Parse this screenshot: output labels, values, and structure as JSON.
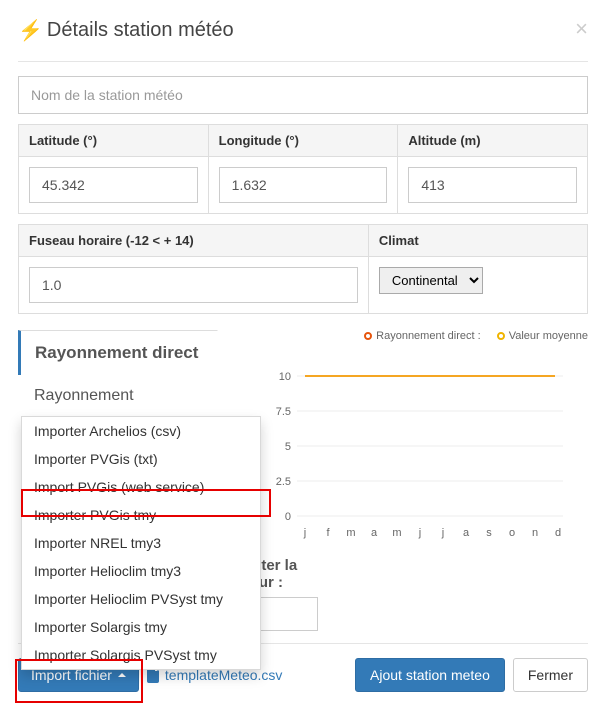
{
  "modal": {
    "title": "Détails station météo",
    "close_label": "×"
  },
  "station_name": {
    "placeholder": "Nom de la station météo",
    "value": ""
  },
  "fields": {
    "latitude": {
      "label": "Latitude (°)",
      "value": "45.342"
    },
    "longitude": {
      "label": "Longitude (°)",
      "value": "1.632"
    },
    "altitude": {
      "label": "Altitude (m)",
      "value": "413"
    },
    "timezone": {
      "label": "Fuseau horaire (-12 < + 14)",
      "value": "1.0"
    },
    "climate": {
      "label": "Climat",
      "value": "Continental"
    }
  },
  "tabs": {
    "active": "Rayonnement direct",
    "next": "Rayonnement"
  },
  "dropdown": {
    "items": [
      "Importer Archelios (csv)",
      "Importer PVGis (txt)",
      "Import PVGis (web service)",
      "Importer PVGis tmy",
      "Importer NREL tmy3",
      "Importer Helioclim tmy3",
      "Importer Helioclim PVSyst tmy",
      "Importer Solargis tmy",
      "Importer Solargis PVSyst tmy"
    ]
  },
  "legend": {
    "series1": "Rayonnement direct :",
    "series2": "Valeur moyenne"
  },
  "chart_data": {
    "type": "line",
    "categories": [
      "j",
      "f",
      "m",
      "a",
      "m",
      "j",
      "j",
      "a",
      "s",
      "o",
      "n",
      "d"
    ],
    "series": [
      {
        "name": "Valeur moyenne",
        "values": [
          10,
          10,
          10,
          10,
          10,
          10,
          10,
          10,
          10,
          10,
          10,
          10
        ],
        "color": "#f5a623"
      }
    ],
    "ylabel": "",
    "xlabel": "",
    "ylim": [
      0,
      10
    ],
    "yticks": [
      0.0,
      2.5,
      5.0,
      7.5,
      10.0
    ]
  },
  "edit": {
    "label_a": "Editer la",
    "label_b": "aleur",
    "value": "0"
  },
  "footer": {
    "import_btn": "Import fichier",
    "template_link": "templateMeteo.csv",
    "add_station": "Ajout station meteo",
    "close": "Fermer"
  }
}
